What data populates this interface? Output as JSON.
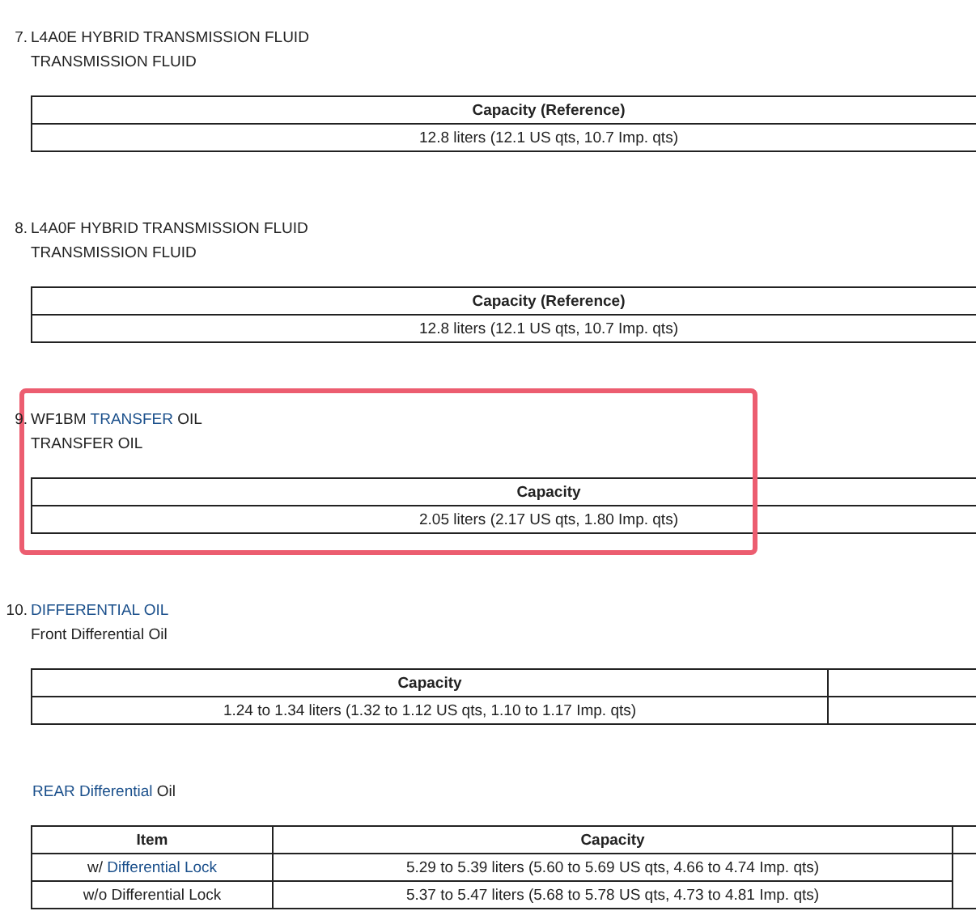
{
  "sections": [
    {
      "number": "7.",
      "annotated": false,
      "title": [
        {
          "text": "L4A0E HYBRID TRANSMISSION FLUID",
          "link": false
        }
      ],
      "subtitle": [
        {
          "text": "TRANSMISSION FLUID",
          "link": false
        }
      ],
      "table": {
        "kind": "single",
        "columns": [
          "Capacity (Reference)"
        ],
        "rows": [
          [
            [
              {
                "text": "12.8 liters (12.1 US qts, 10.7 Imp. qts)",
                "link": false
              }
            ]
          ]
        ]
      }
    },
    {
      "number": "8.",
      "annotated": false,
      "title": [
        {
          "text": "L4A0F HYBRID TRANSMISSION FLUID",
          "link": false
        }
      ],
      "subtitle": [
        {
          "text": "TRANSMISSION FLUID",
          "link": false
        }
      ],
      "table": {
        "kind": "single",
        "columns": [
          "Capacity (Reference)"
        ],
        "rows": [
          [
            [
              {
                "text": "12.8 liters (12.1 US qts, 10.7 Imp. qts)",
                "link": false
              }
            ]
          ]
        ]
      }
    },
    {
      "number": "9.",
      "annotated": true,
      "title": [
        {
          "text": "WF1BM ",
          "link": false
        },
        {
          "text": "TRANSFER",
          "link": true
        },
        {
          "text": " OIL",
          "link": false
        }
      ],
      "subtitle": [
        {
          "text": "TRANSFER OIL",
          "link": false
        }
      ],
      "table": {
        "kind": "single",
        "columns": [
          "Capacity"
        ],
        "rows": [
          [
            [
              {
                "text": "2.05 liters (2.17 US qts, 1.80 Imp. qts)",
                "link": false
              }
            ]
          ]
        ]
      }
    },
    {
      "number": "10.",
      "annotated": false,
      "title": [
        {
          "text": "DIFFERENTIAL OIL",
          "link": true
        }
      ],
      "subtitle": [
        {
          "text": "Front Differential Oil",
          "link": false
        }
      ],
      "table": {
        "kind": "side",
        "columns": [
          "Capacity"
        ],
        "rows": [
          [
            [
              {
                "text": "1.24 to 1.34 liters (1.32 to 1.12 US qts, 1.10 to 1.17 Imp. qts)",
                "link": false
              }
            ]
          ]
        ]
      }
    },
    {
      "annotated": false,
      "title": [
        {
          "text": "REAR Differential",
          "link": true
        },
        {
          "text": " Oil",
          "link": false
        }
      ],
      "table": {
        "kind": "items",
        "columns": [
          "Item",
          "Capacity"
        ],
        "rows": [
          [
            [
              {
                "text": "w/ ",
                "link": false
              },
              {
                "text": "Differential Lock",
                "link": true
              }
            ],
            [
              {
                "text": "5.29 to 5.39 liters (5.60 to 5.69 US qts, 4.66 to 4.74 Imp. qts)",
                "link": false
              }
            ]
          ],
          [
            [
              {
                "text": "w/o Differential Lock",
                "link": false
              }
            ],
            [
              {
                "text": "5.37 to 5.47 liters (5.68 to 5.78 US qts, 4.73 to 4.81 Imp. qts)",
                "link": false
              }
            ]
          ]
        ]
      }
    }
  ]
}
